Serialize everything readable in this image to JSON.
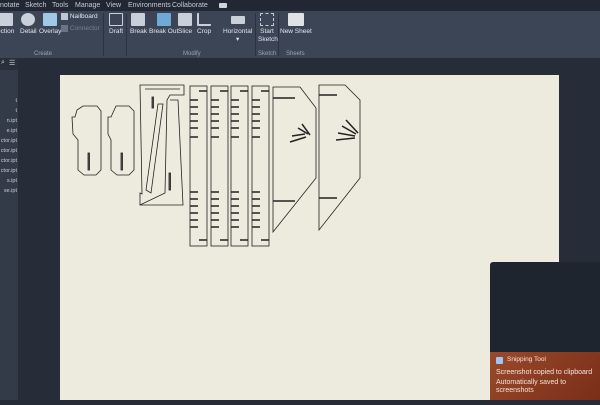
{
  "menu": [
    "notate",
    "Sketch",
    "Tools",
    "Manage",
    "View",
    "Environments",
    "Collaborate"
  ],
  "ribbon": {
    "buttons": [
      "ection",
      "Detail",
      "Overlay",
      "Draft",
      "Break",
      "Break Out",
      "Slice",
      "Crop",
      "Horizontal",
      "Start Sketch",
      "New Sheet"
    ],
    "small": [
      "Nailboard",
      "Connector"
    ],
    "groups": [
      "Create",
      "Modify",
      "Sketch",
      "Sheets"
    ]
  },
  "browser": {
    "items": [
      "t",
      "t",
      "n.ipt",
      "e.ipt",
      "ctor.ipt",
      "ctor.ipt",
      "ctor.ipt",
      "ctor.ipt",
      "s.ipt",
      "se.ipt"
    ]
  },
  "toast": {
    "app": "Snipping Tool",
    "title": "Screenshot copied to clipboard",
    "body": "Automatically saved to screenshots"
  }
}
